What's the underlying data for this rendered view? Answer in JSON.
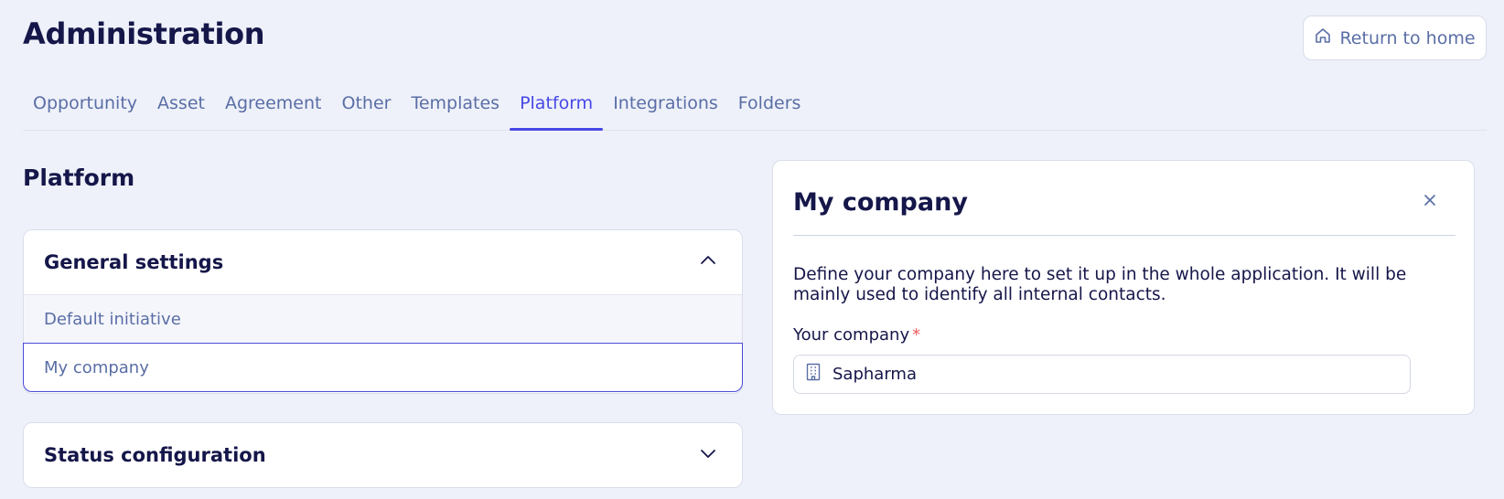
{
  "header": {
    "title": "Administration",
    "return_home_label": "Return to home"
  },
  "tabs": [
    {
      "label": "Opportunity",
      "active": false
    },
    {
      "label": "Asset",
      "active": false
    },
    {
      "label": "Agreement",
      "active": false
    },
    {
      "label": "Other",
      "active": false
    },
    {
      "label": "Templates",
      "active": false
    },
    {
      "label": "Platform",
      "active": true
    },
    {
      "label": "Integrations",
      "active": false
    },
    {
      "label": "Folders",
      "active": false
    }
  ],
  "section": {
    "title": "Platform"
  },
  "general_settings": {
    "title": "General settings",
    "expanded": true,
    "items": [
      {
        "label": "Default initiative",
        "selected": false
      },
      {
        "label": "My company",
        "selected": true
      }
    ]
  },
  "status_configuration": {
    "title": "Status configuration",
    "expanded": false
  },
  "panel": {
    "title": "My company",
    "description": "Define your company here to set it up in the whole application. It will be mainly used to identify all internal contacts.",
    "field_label": "Your company",
    "required_mark": "*",
    "field_value": "Sapharma"
  },
  "icons": {
    "home": "home-icon",
    "close": "close-icon",
    "chevron_up": "chevron-up-icon",
    "chevron_down": "chevron-down-icon",
    "building": "building-icon"
  },
  "colors": {
    "background": "#eef1f9",
    "accent": "#4747e6",
    "text_dark": "#151649",
    "text_muted": "#5a6ea6",
    "required": "#ef5a5a"
  }
}
